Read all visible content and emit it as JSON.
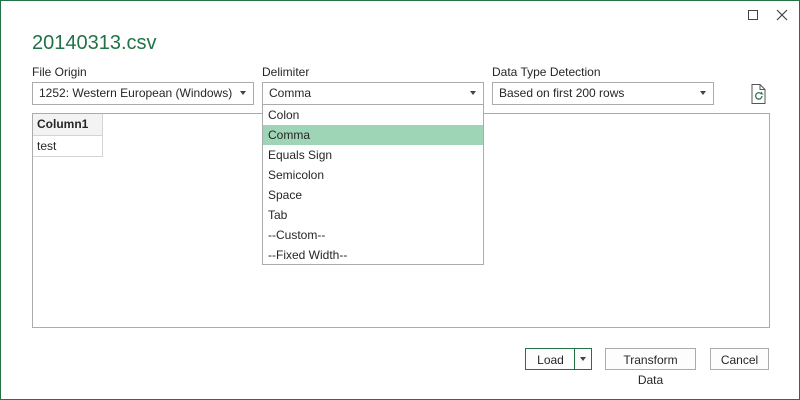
{
  "dialog": {
    "title": "20140313.csv",
    "maximize_icon": "maximize-icon",
    "close_icon": "close-icon"
  },
  "file_origin": {
    "label": "File Origin",
    "value": "1252: Western European (Windows)"
  },
  "delimiter": {
    "label": "Delimiter",
    "value": "Comma",
    "options": [
      "Colon",
      "Comma",
      "Equals Sign",
      "Semicolon",
      "Space",
      "Tab",
      "--Custom--",
      "--Fixed Width--"
    ],
    "selected_index": 1
  },
  "data_type_detection": {
    "label": "Data Type Detection",
    "value": "Based on first 200 rows"
  },
  "refresh_icon": "refresh-document-icon",
  "preview": {
    "columns": [
      "Column1"
    ],
    "rows": [
      [
        "test"
      ]
    ]
  },
  "buttons": {
    "load": "Load",
    "transform": "Transform Data",
    "cancel": "Cancel"
  },
  "colors": {
    "accent": "#217346",
    "selected_item": "#9fd5b7"
  }
}
